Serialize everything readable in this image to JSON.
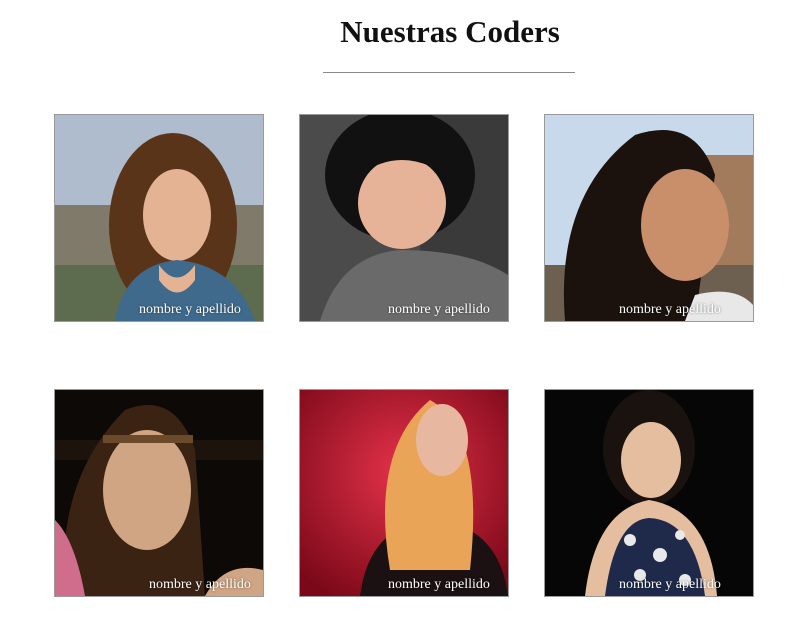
{
  "page": {
    "title": "Nuestras Coders"
  },
  "coders": [
    {
      "caption": "nombre y apellido",
      "photo": "portrait-curly-brown-hair-outdoors"
    },
    {
      "caption": "nombre y apellido",
      "photo": "portrait-black-bob-hair-dark-background"
    },
    {
      "caption": "nombre y apellido",
      "photo": "portrait-profile-sky-background"
    },
    {
      "caption": "nombre y apellido",
      "photo": "portrait-headband-night"
    },
    {
      "caption": "nombre y apellido",
      "photo": "portrait-blonde-red-light"
    },
    {
      "caption": "nombre y apellido",
      "photo": "portrait-patterned-dress-black-background"
    }
  ]
}
